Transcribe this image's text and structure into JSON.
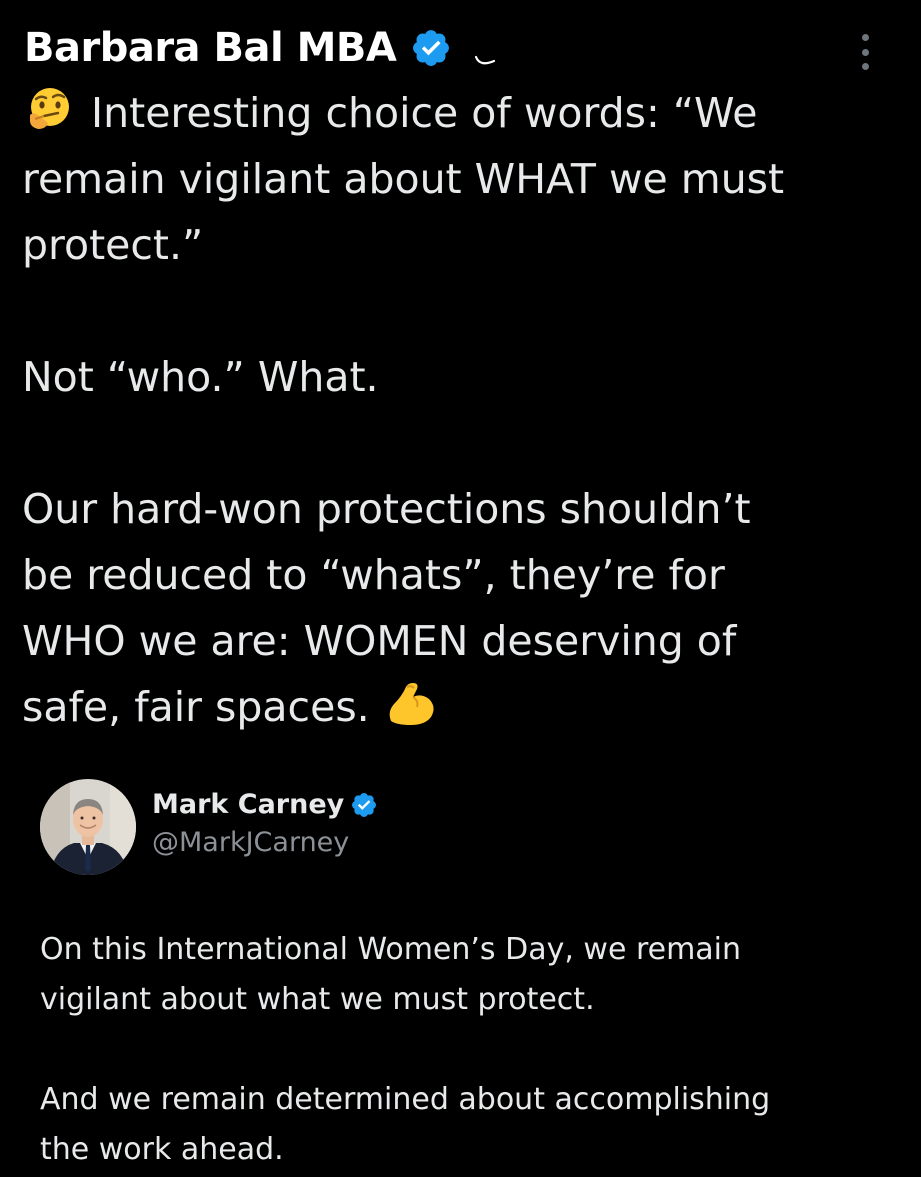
{
  "tweet": {
    "author_name": "Barbara Bal MBA",
    "verified_icon": "verified-badge-icon",
    "body_lines": [
      "Interesting choice of words: “We",
      "remain vigilant about WHAT we must",
      "protect.”",
      "Not “who.” What.",
      "Our hard-won protections shouldn’t",
      "be reduced to “whats”, they’re for",
      "WHO we are: WOMEN deserving of",
      "safe, fair spaces."
    ],
    "leading_emoji": "thinking-face-emoji",
    "trailing_emoji": "flexed-biceps-emoji"
  },
  "quoted_tweet": {
    "author_name": "Mark Carney",
    "handle": "@MarkJCarney",
    "avatar": "profile-photo",
    "text_lines": [
      "On this International Women’s Day, we remain",
      "vigilant about what we must protect.",
      "And we remain determined about accomplishing",
      "the work ahead."
    ]
  },
  "colors": {
    "background": "#000000",
    "text": "#e7e9ea",
    "secondary_text": "#8b9196",
    "verified_blue": "#1d9bf0"
  }
}
